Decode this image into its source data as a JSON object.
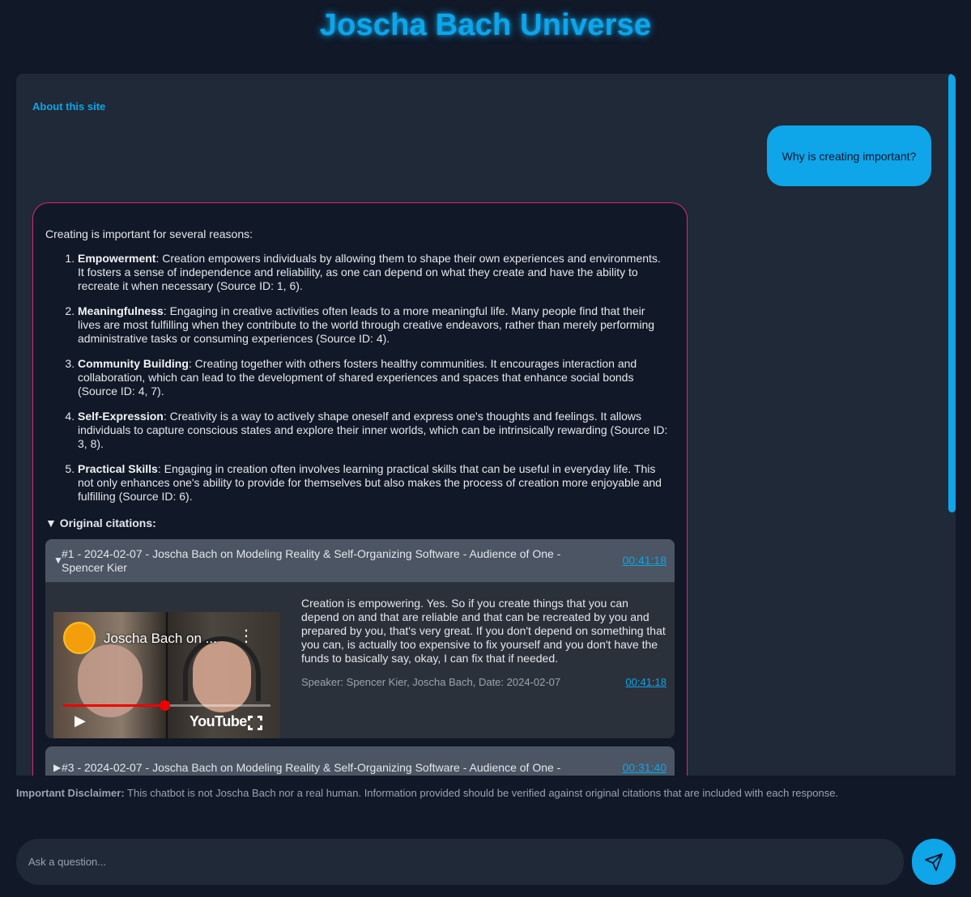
{
  "header": {
    "title": "Joscha Bach Universe"
  },
  "chat": {
    "about_link": "About this site",
    "user_message": "Why is creating important?",
    "bot": {
      "intro": "Creating is important for several reasons:",
      "reasons": [
        {
          "title": "Empowerment",
          "text": ": Creation empowers individuals by allowing them to shape their own experiences and environments. It fosters a sense of independence and reliability, as one can depend on what they create and have the ability to recreate it when necessary (Source ID: 1, 6)."
        },
        {
          "title": "Meaningfulness",
          "text": ": Engaging in creative activities often leads to a more meaningful life. Many people find that their lives are most fulfilling when they contribute to the world through creative endeavors, rather than merely performing administrative tasks or consuming experiences (Source ID: 4)."
        },
        {
          "title": "Community Building",
          "text": ": Creating together with others fosters healthy communities. It encourages interaction and collaboration, which can lead to the development of shared experiences and spaces that enhance social bonds (Source ID: 4, 7)."
        },
        {
          "title": "Self-Expression",
          "text": ": Creativity is a way to actively shape oneself and express one's thoughts and feelings. It allows individuals to capture conscious states and explore their inner worlds, which can be intrinsically rewarding (Source ID: 3, 8)."
        },
        {
          "title": "Practical Skills",
          "text": ": Engaging in creation often involves learning practical skills that can be useful in everyday life. This not only enhances one's ability to provide for themselves but also makes the process of creation more enjoyable and fulfilling (Source ID: 6)."
        }
      ],
      "citations_label": "Original citations:",
      "citations_caret": "▼",
      "citations": [
        {
          "caret": "▼",
          "title": "#1 - 2024-02-07 - Joscha Bach on Modeling Reality & Self-Organizing Software - Audience of One - Spencer Kier",
          "timestamp": "00:41:18",
          "video": {
            "title": "Joscha Bach on ...",
            "logo_text": "YouTube",
            "progress": 0.49
          },
          "quote": "Creation is empowering. Yes. So if you create things that you can depend on and that are reliable and that can be recreated by you and prepared by you, that's very great. If you don't depend on something that you can, is actually too expensive to fix yourself and you don't have the funds to basically say, okay, I can fix that if needed.",
          "meta": "Speaker: Spencer Kier, Joscha Bach, Date: 2024-02-07",
          "meta_timestamp": "00:41:18"
        },
        {
          "caret": "▶",
          "title": "#3 - 2024-02-07 - Joscha Bach on Modeling Reality & Self-Organizing Software - Audience of One -",
          "timestamp": "00:31:40"
        }
      ]
    }
  },
  "footer": {
    "disclaimer_label": "Important Disclaimer:",
    "disclaimer_text": " This chatbot is not Joscha Bach nor a real human. Information provided should be verified against original citations that are included with each response.",
    "input_placeholder": "Ask a question...",
    "send_icon": "send-icon"
  },
  "colors": {
    "accent": "#0ea5e9",
    "bot_border": "#db2777",
    "background": "#111827",
    "panel": "#1f2937"
  }
}
